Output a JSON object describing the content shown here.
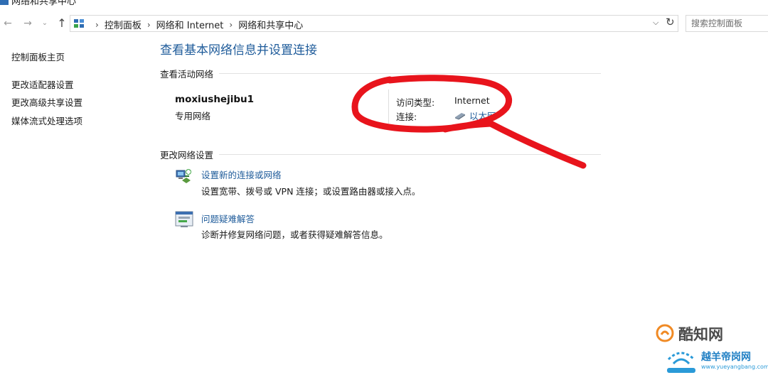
{
  "window": {
    "title": "网络和共享中心"
  },
  "address_bar": {
    "breadcrumbs": [
      "控制面板",
      "网络和 Internet",
      "网络和共享中心"
    ],
    "search_placeholder": "搜索控制面板"
  },
  "sidebar": {
    "items": [
      {
        "label": "控制面板主页"
      },
      {
        "label": "更改适配器设置"
      },
      {
        "label": "更改高级共享设置"
      },
      {
        "label": "媒体流式处理选项"
      }
    ]
  },
  "main": {
    "heading": "查看基本网络信息并设置连接",
    "active_networks": {
      "title": "查看活动网络",
      "network_name": "moxiushejibu1",
      "network_type": "专用网络",
      "access_type_label": "访问类型:",
      "access_type_value": "Internet",
      "connection_label": "连接:",
      "connection_value": "以太网"
    },
    "change_settings": {
      "title": "更改网络设置",
      "tasks": [
        {
          "link": "设置新的连接或网络",
          "desc": "设置宽带、拨号或 VPN 连接；或设置路由器或接入点。",
          "icon": "network-setup-icon"
        },
        {
          "link": "问题疑难解答",
          "desc": "诊断并修复网络问题，或者获得疑难解答信息。",
          "icon": "troubleshoot-icon"
        }
      ]
    }
  },
  "watermarks": {
    "top": "酷知网",
    "bottom": "越羊帝岗网",
    "url": "www.yueyangbang.com"
  },
  "colors": {
    "link": "#1e5b9a",
    "annotation": "#e8141c"
  }
}
